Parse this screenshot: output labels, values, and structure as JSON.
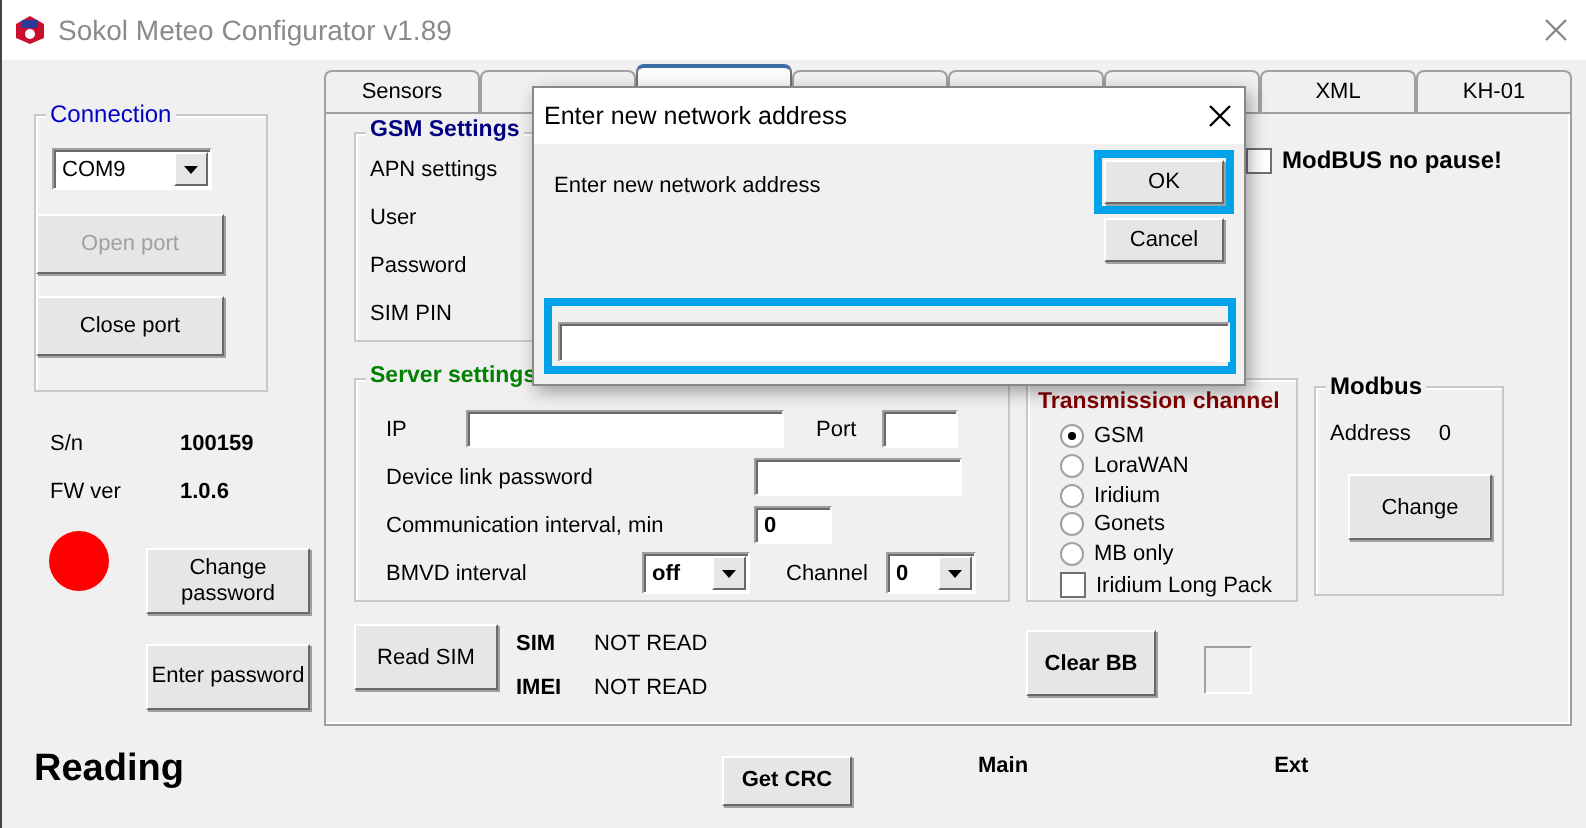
{
  "window": {
    "title": "Sokol Meteo Configurator v1.89"
  },
  "connection": {
    "title": "Connection",
    "port": "COM9",
    "buttons": [
      {
        "label": "Open port",
        "disabled": true
      },
      {
        "label": "Close port",
        "disabled": false
      }
    ]
  },
  "device_info": [
    {
      "label": "S/n",
      "value": "100159"
    },
    {
      "label": "FW ver",
      "value": "1.0.6"
    }
  ],
  "password_buttons": [
    "Change password",
    "Enter password"
  ],
  "status": "Reading",
  "tabs": [
    {
      "label": "Sensors",
      "selected": false
    },
    {
      "selected": false
    },
    {
      "selected": true
    },
    {
      "selected": false
    },
    {
      "selected": false
    },
    {
      "selected": false
    },
    {
      "label": "XML",
      "selected": false
    },
    {
      "label": "KH-01",
      "selected": false
    }
  ],
  "gsm_settings": {
    "title": "GSM Settings",
    "fields": [
      "APN settings",
      "User",
      "Password",
      "SIM PIN"
    ]
  },
  "modbus_no_pause": {
    "label": "ModBUS no pause!",
    "checked": false
  },
  "server_settings": {
    "title": "Server settings",
    "ip_label": "IP",
    "port_label": "Port",
    "link_password_label": "Device link password",
    "interval_label": "Communication interval, min",
    "interval_value": "0",
    "bmvd_label": "BMVD interval",
    "bmvd_value": "off",
    "channel_label": "Channel",
    "channel_value": "0"
  },
  "sim": {
    "button": "Read SIM",
    "rows": [
      {
        "label": "SIM",
        "value": "NOT READ"
      },
      {
        "label": "IMEI",
        "value": "NOT READ"
      }
    ]
  },
  "transmission_channel": {
    "title": "Transmission channel",
    "options": [
      {
        "label": "GSM",
        "selected": true
      },
      {
        "label": "LoraWAN",
        "selected": false
      },
      {
        "label": "Iridium",
        "selected": false
      },
      {
        "label": "Gonets",
        "selected": false
      },
      {
        "label": "MB only",
        "selected": false
      }
    ],
    "long_pack": {
      "label": "Iridium Long Pack",
      "checked": false
    }
  },
  "modbus": {
    "title": "Modbus",
    "address_label": "Address",
    "address_value": "0",
    "button": "Change"
  },
  "clear_bb": "Clear BB",
  "bottom": {
    "crc_button": "Get CRC",
    "main": "Main",
    "ext": "Ext"
  },
  "dialog": {
    "title": "Enter new network address",
    "prompt": "Enter new network address",
    "ok": {
      "label": "OK",
      "highlighted": true
    },
    "cancel": {
      "label": "Cancel",
      "highlighted": false
    },
    "input": {
      "highlighted": true
    }
  }
}
